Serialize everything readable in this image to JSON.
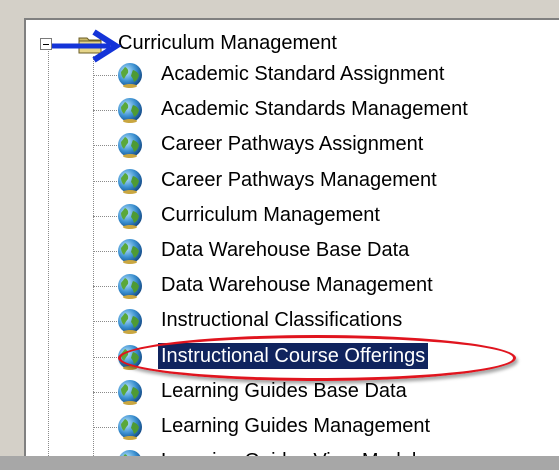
{
  "tree": {
    "root": {
      "label": "Curriculum Management",
      "expanded": true,
      "icon": "folder-icon"
    },
    "items": [
      {
        "label": "Academic Standard Assignment",
        "icon": "globe-icon"
      },
      {
        "label": "Academic Standards Management",
        "icon": "globe-icon"
      },
      {
        "label": "Career Pathways Assignment",
        "icon": "globe-icon"
      },
      {
        "label": "Career Pathways Management",
        "icon": "globe-icon"
      },
      {
        "label": "Curriculum Management",
        "icon": "globe-icon"
      },
      {
        "label": "Data Warehouse Base Data",
        "icon": "globe-icon"
      },
      {
        "label": "Data Warehouse Management",
        "icon": "globe-icon"
      },
      {
        "label": "Instructional Classifications",
        "icon": "globe-icon"
      },
      {
        "label": "Instructional Course Offerings",
        "icon": "globe-icon",
        "selected": true
      },
      {
        "label": "Learning Guides Base Data",
        "icon": "globe-icon"
      },
      {
        "label": "Learning Guides Management",
        "icon": "globe-icon"
      },
      {
        "label": "Learning Guides View Model",
        "icon": "globe-icon"
      }
    ]
  },
  "colors": {
    "selection": "#10245e",
    "annotation_arrow": "#1434d8",
    "annotation_oval": "#e0141e"
  }
}
